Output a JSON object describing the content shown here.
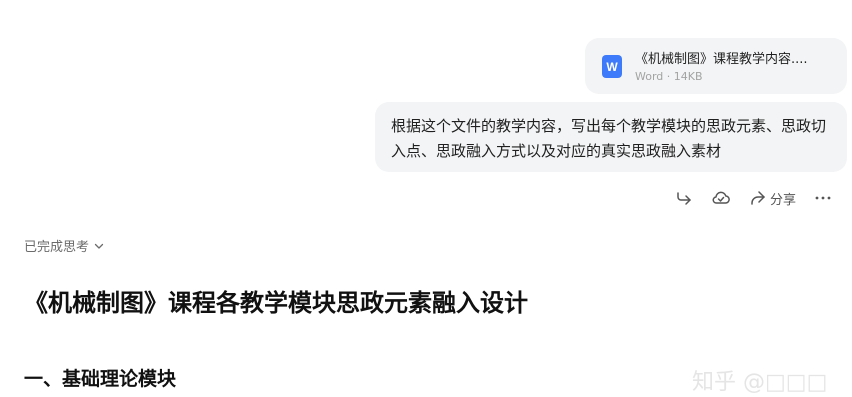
{
  "attachment": {
    "icon": "word-doc-icon",
    "icon_letter": "W",
    "file_name": "《机械制图》课程教学内容....",
    "meta": "Word · 14KB"
  },
  "user_message": {
    "text": "根据这个文件的教学内容，写出每个教学模块的思政元素、思政切入点、思政融入方式以及对应的真实思政融入素材"
  },
  "actions": {
    "share_label": "分享",
    "icons": [
      "forward-icon",
      "cloud-save-icon",
      "share-icon",
      "more-icon"
    ]
  },
  "thinking": {
    "label": "已完成思考"
  },
  "answer": {
    "title": "《机械制图》课程各教学模块思政元素融入设计",
    "section_1": "一、基础理论模块"
  },
  "watermark": {
    "text": "知乎 @□□□"
  },
  "colors": {
    "bubble": "#f3f4f6",
    "word_blue": "#3d7bfb",
    "muted": "#a3a3a3"
  }
}
